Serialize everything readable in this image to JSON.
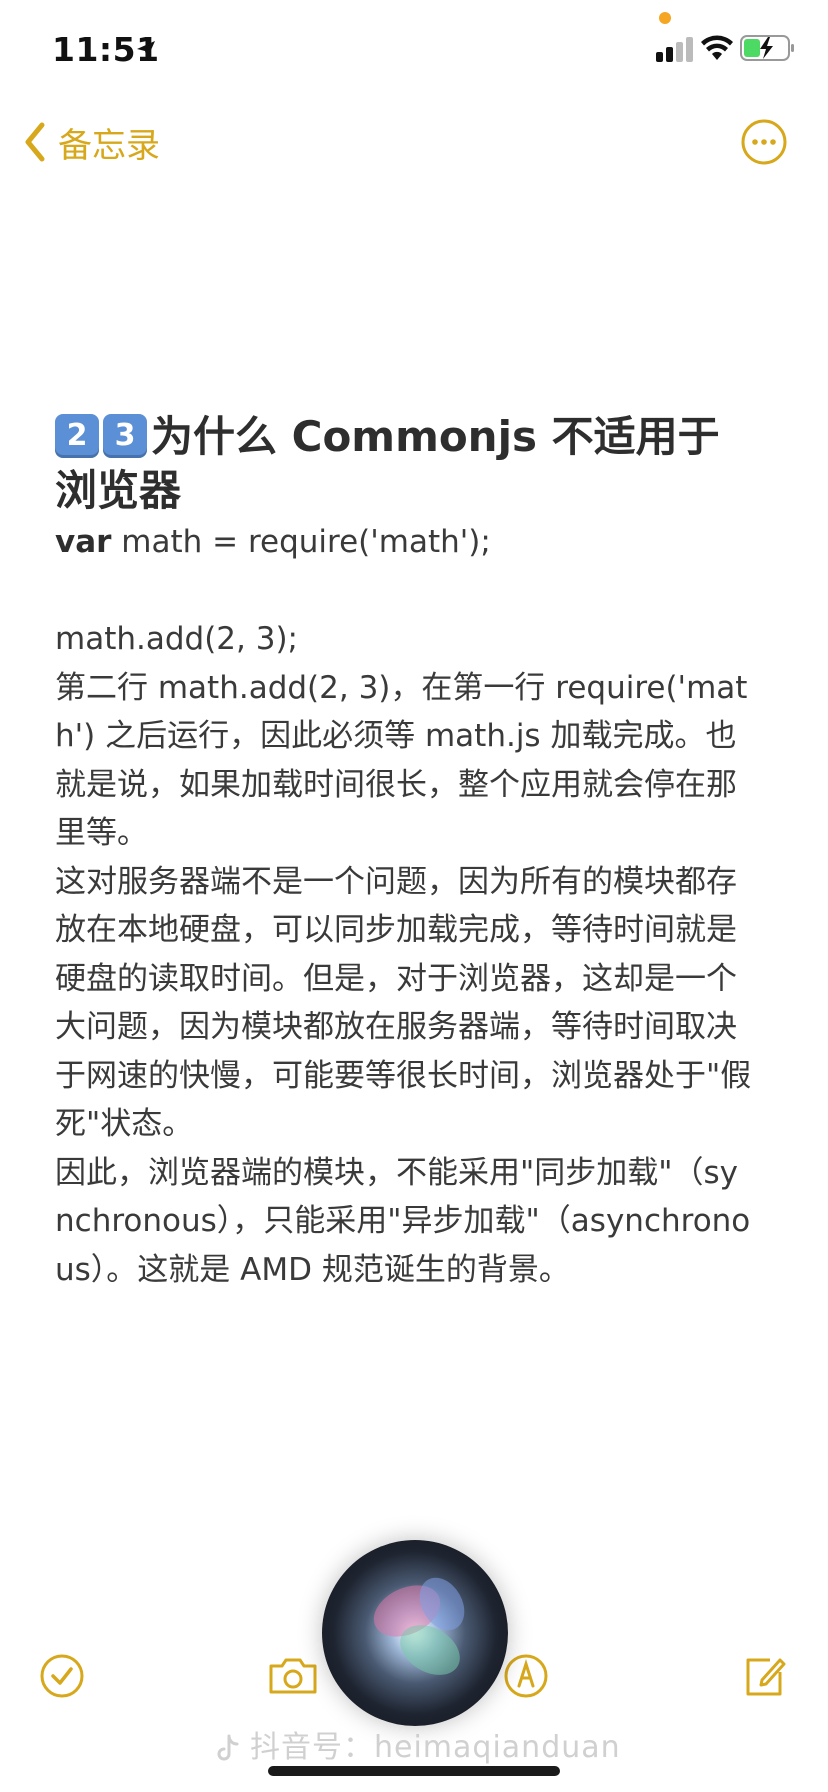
{
  "status_bar": {
    "time": "11:51",
    "colors": {
      "orange_dot": "#f5a623",
      "battery_fill": "#4cd964"
    }
  },
  "nav": {
    "back_label": "备忘录",
    "accent_color": "#d7a81c"
  },
  "note": {
    "title_keycaps": [
      "2",
      "3"
    ],
    "title_text": "为什么 Commonjs 不适用于浏览器",
    "code_keyword": "var",
    "code_line_1_rest": " math = require('math');",
    "code_line_2": "math.add(2, 3);",
    "paragraphs": [
      "第二行 math.add(2, 3)，在第一行 require('math') 之后运行，因此必须等 math.js 加载完成。也就是说，如果加载时间很长，整个应用就会停在那里等。",
      "这对服务器端不是一个问题，因为所有的模块都存放在本地硬盘，可以同步加载完成，等待时间就是硬盘的读取时间。但是，对于浏览器，这却是一个大问题，因为模块都放在服务器端，等待时间取决于网速的快慢，可能要等很长时间，浏览器处于\"假死\"状态。",
      "因此，浏览器端的模块，不能采用\"同步加载\"（synchronous），只能采用\"异步加载\"（asynchronous）。这就是 AMD 规范诞生的背景。"
    ]
  },
  "toolbar": {
    "icons": [
      "checklist-icon",
      "camera-icon",
      "markup-icon",
      "compose-icon"
    ]
  },
  "watermark": {
    "text": "抖音号：heimaqianduan"
  }
}
